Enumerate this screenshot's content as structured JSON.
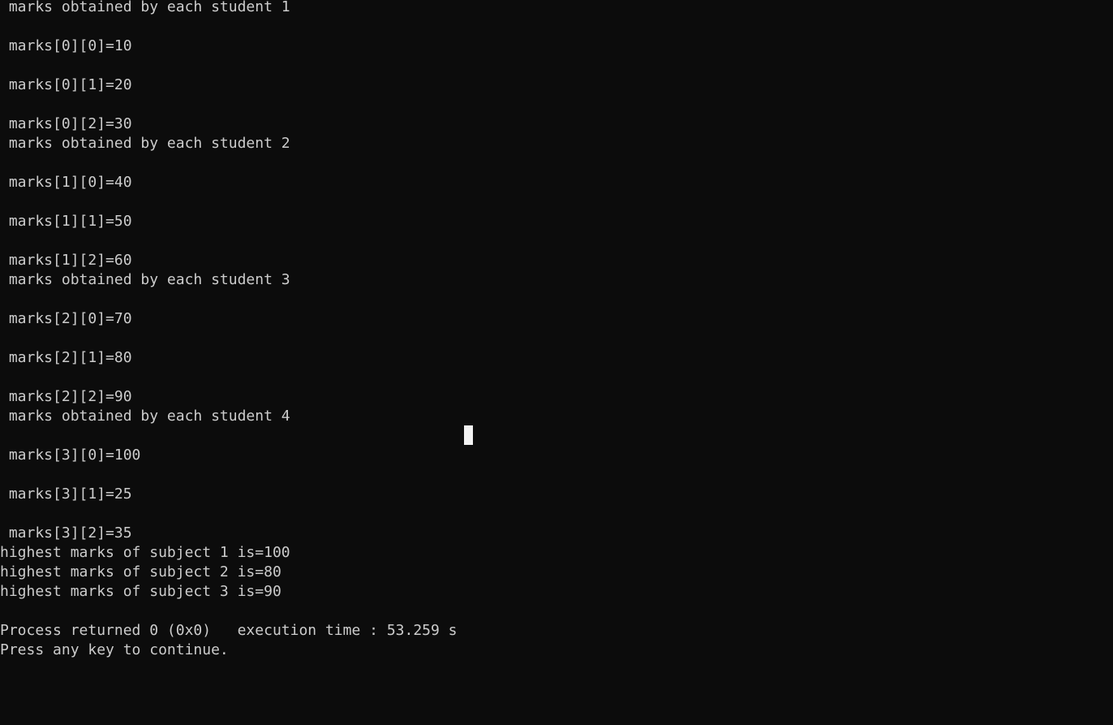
{
  "console": {
    "lines": [
      " marks obtained by each student 1",
      "",
      " marks[0][0]=10",
      "",
      " marks[0][1]=20",
      "",
      " marks[0][2]=30",
      " marks obtained by each student 2",
      "",
      " marks[1][0]=40",
      "",
      " marks[1][1]=50",
      "",
      " marks[1][2]=60",
      " marks obtained by each student 3",
      "",
      " marks[2][0]=70",
      "",
      " marks[2][1]=80",
      "",
      " marks[2][2]=90",
      " marks obtained by each student 4",
      "",
      " marks[3][0]=100",
      "",
      " marks[3][1]=25",
      "",
      " marks[3][2]=35",
      "highest marks of subject 1 is=100",
      "highest marks of subject 2 is=80",
      "highest marks of subject 3 is=90",
      "",
      "Process returned 0 (0x0)   execution time : 53.259 s",
      "Press any key to continue."
    ]
  },
  "colors": {
    "background": "#0c0c0c",
    "text": "#cccccc",
    "cursor": "#f2f2f2"
  }
}
